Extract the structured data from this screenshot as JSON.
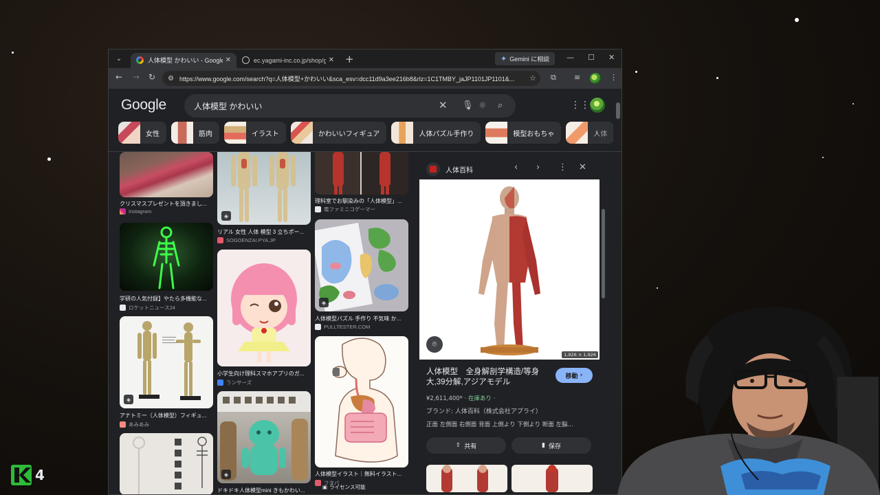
{
  "browser": {
    "tabs": [
      {
        "title": "人体模型 かわいい - Google 検索",
        "active": true
      },
      {
        "title": "ec.yagami-inc.co.jp/shop/goods",
        "active": false
      }
    ],
    "gemini_label": "Gemini に相談",
    "url": "https://www.google.com/search?q=人体模型+かわいい&sca_esv=dcc11d9a3ee216b8&rlz=1C1TMBY_jaJP1101JP1101&..."
  },
  "google": {
    "logo": "Google",
    "query": "人体模型 かわいい",
    "chips": [
      "女性",
      "筋肉",
      "イラスト",
      "かわいいフィギュア",
      "人体パズル手作り",
      "模型おもちゃ",
      "人体"
    ]
  },
  "results": {
    "col1": [
      {
        "caption": "クリスマスプレゼントを頂きまし...",
        "source": "Instagram"
      },
      {
        "caption": "学研の人気付録】やたら多機能な...",
        "source": "ロケットニュース24"
      },
      {
        "caption": "アナトミー（人体模型）フィギュ...",
        "source": "あみあみ"
      },
      {
        "caption": "",
        "source": ""
      }
    ],
    "col2": [
      {
        "caption": "リアル 女性 人体 模型 3 立ちポー...",
        "source": "SOGOENZAI.PYA.JP"
      },
      {
        "caption": "小学生向け理科スマホアプリのガ...",
        "source": "ランサーズ"
      },
      {
        "caption": "ドキドキ人体模型mini きもかわい...",
        "source": ""
      }
    ],
    "col3": [
      {
        "caption": "理科室でお馴染みの「人体模型」...",
        "source": "電ファミニコゲーマー"
      },
      {
        "caption": "人体模型パズル 手作り 不気味 か...",
        "source": "PULLTESTER.COM"
      },
      {
        "caption": "人体模型イラスト｜無料イラスト...",
        "source": "フタバ",
        "license": "ライセンス可能"
      }
    ]
  },
  "panel": {
    "site": "人体百科",
    "dimensions": "1,926 × 1,926",
    "title": "人体模型　全身解剖学構造/等身大,39分解,アジアモデル",
    "visit_label": "移動",
    "price": "¥2,611,400*",
    "stock": "在庫あり",
    "brand": "ブランド: 人体百科（株式会社アプライ）",
    "tags": "正面 左側面 右側面 背面 上側より 下側より 断面 左脳...",
    "share_label": "共有",
    "save_label": "保存"
  },
  "overlay": {
    "logo_text": "4"
  },
  "colors": {
    "accent": "#8ab4f8",
    "in_stock": "#81c995",
    "stream_logo": "#2dbb39"
  }
}
